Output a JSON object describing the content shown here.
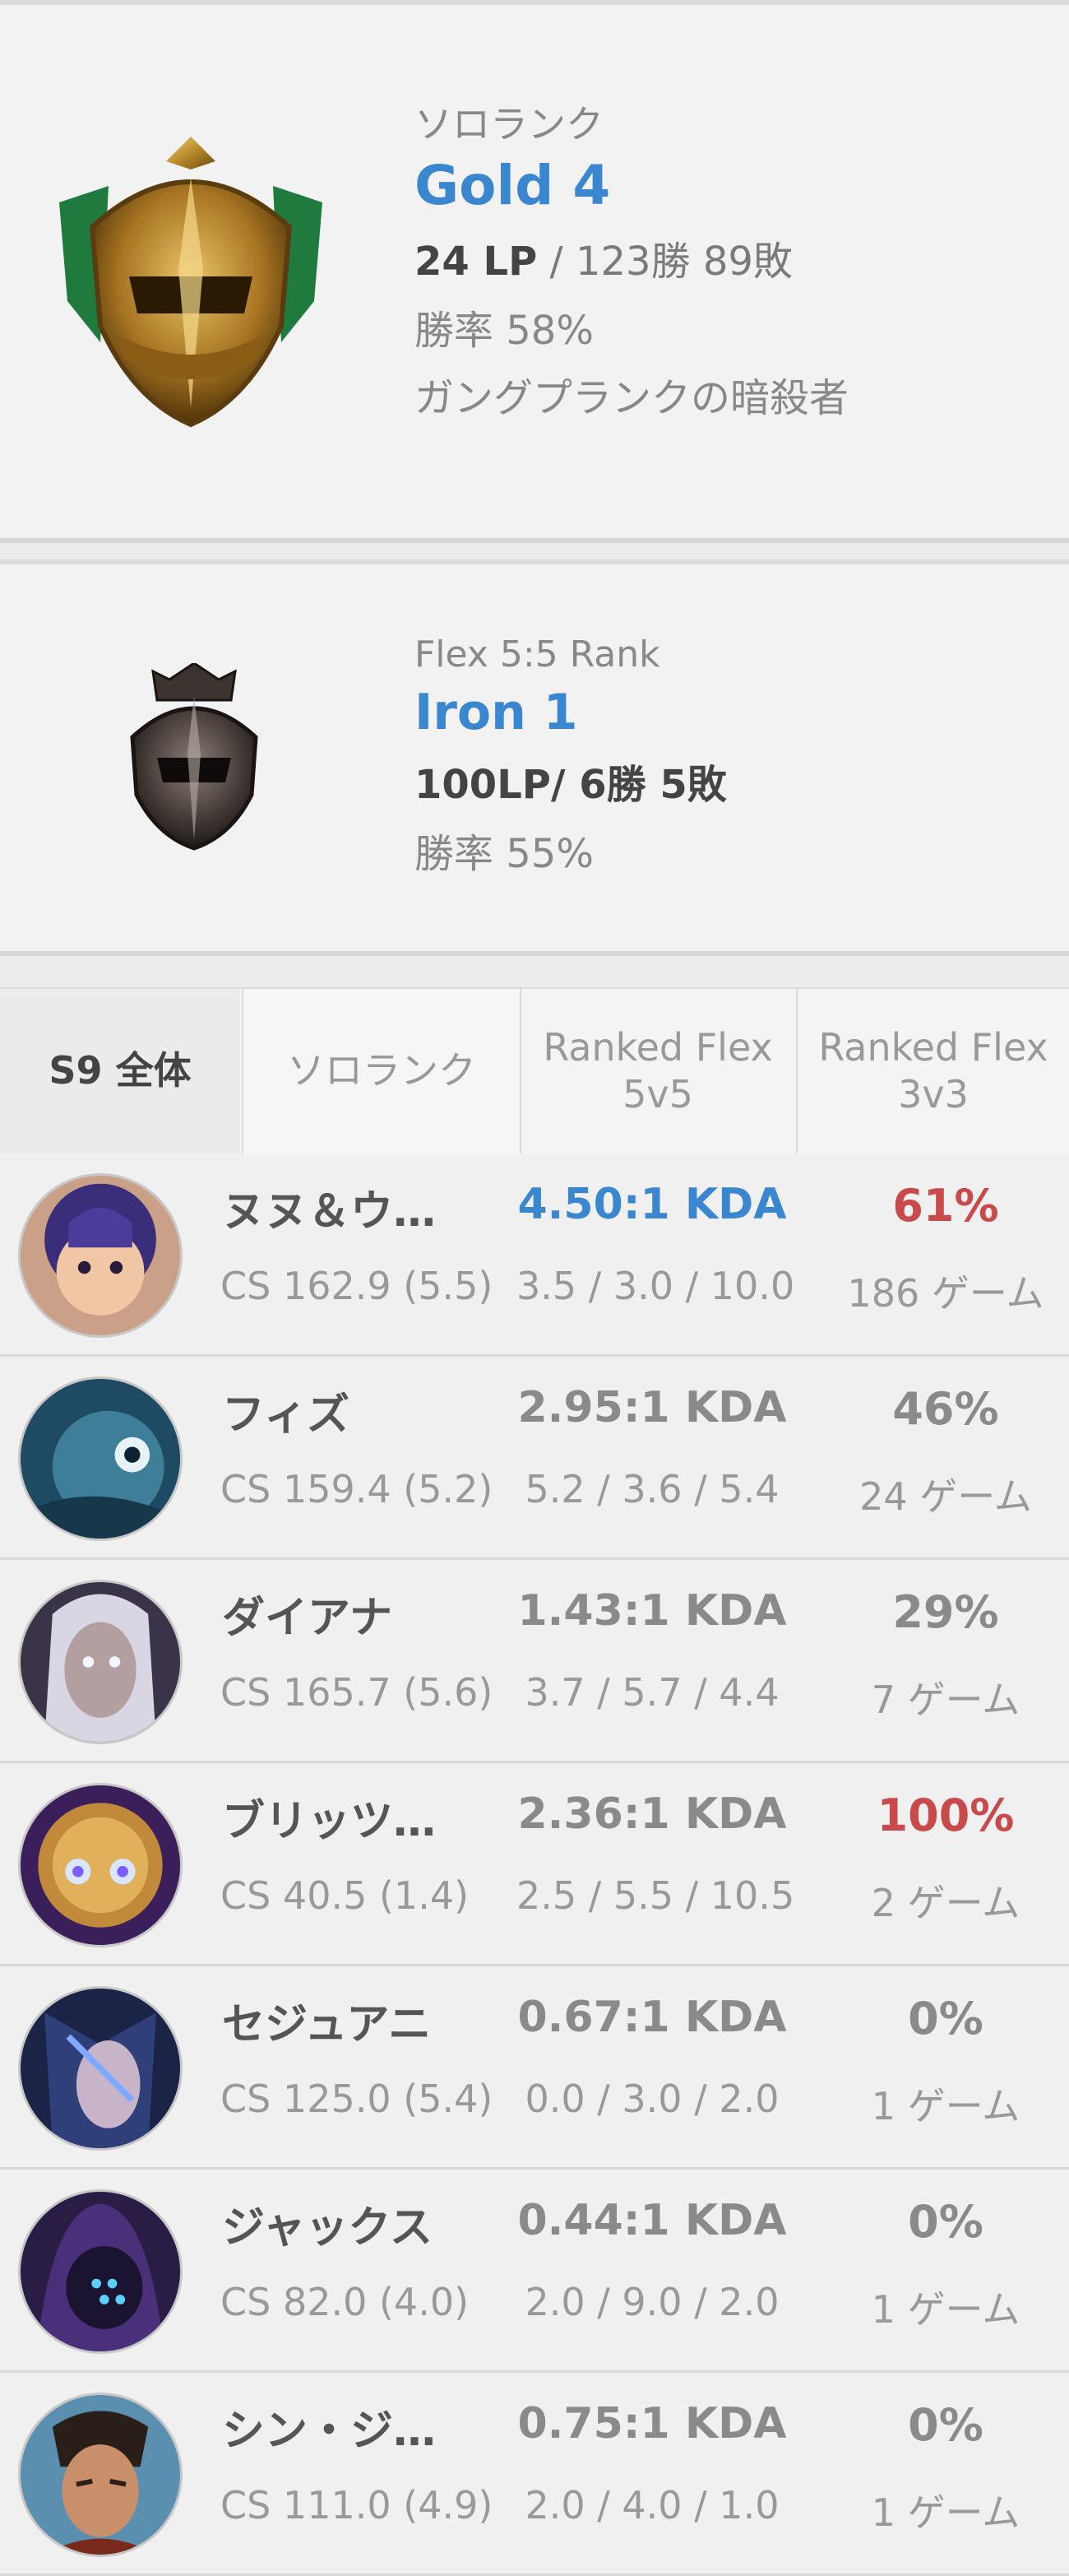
{
  "solo_rank": {
    "queue": "ソロランク",
    "tier": "Gold 4",
    "lp": "24 LP",
    "record": " / 123勝 89敗",
    "winrate": "勝率 58%",
    "league": "ガングプランクの暗殺者",
    "emblem_icon": "gold-helmet-emblem"
  },
  "flex_rank": {
    "queue": "Flex 5:5 Rank",
    "tier": "Iron 1",
    "lp": "100LP",
    "record": "/ 6勝 5敗",
    "winrate": "勝率 55%",
    "emblem_icon": "iron-helmet-emblem"
  },
  "tabs": [
    {
      "label": "S9 全体"
    },
    {
      "label": "ソロランク"
    },
    {
      "label": "Ranked Flex 5v5"
    },
    {
      "label": "Ranked Flex 3v3"
    }
  ],
  "champions": [
    {
      "name": "ヌヌ＆ウ…",
      "cs": "CS 162.9 (5.5)",
      "kda": "4.50:1 KDA",
      "kda_detail": "3.5 / 3.0 / 10.0",
      "winrate": "61%",
      "games": "186 ゲーム"
    },
    {
      "name": "フィズ",
      "cs": "CS 159.4 (5.2)",
      "kda": "2.95:1 KDA",
      "kda_detail": "5.2 / 3.6 / 5.4",
      "winrate": "46%",
      "games": "24 ゲーム"
    },
    {
      "name": "ダイアナ",
      "cs": "CS 165.7 (5.6)",
      "kda": "1.43:1 KDA",
      "kda_detail": "3.7 / 5.7 / 4.4",
      "winrate": "29%",
      "games": "7 ゲーム"
    },
    {
      "name": "ブリッツ…",
      "cs": "CS 40.5 (1.4)",
      "kda": "2.36:1 KDA",
      "kda_detail": "2.5 / 5.5 / 10.5",
      "winrate": "100%",
      "games": "2 ゲーム"
    },
    {
      "name": "セジュアニ",
      "cs": "CS 125.0 (5.4)",
      "kda": "0.67:1 KDA",
      "kda_detail": "0.0 / 3.0 / 2.0",
      "winrate": "0%",
      "games": "1 ゲーム"
    },
    {
      "name": "ジャックス",
      "cs": "CS 82.0 (4.0)",
      "kda": "0.44:1 KDA",
      "kda_detail": "2.0 / 9.0 / 2.0",
      "winrate": "0%",
      "games": "1 ゲーム"
    },
    {
      "name": "シン・ジ…",
      "cs": "CS 111.0 (4.9)",
      "kda": "0.75:1 KDA",
      "kda_detail": "2.0 / 4.0 / 1.0",
      "winrate": "0%",
      "games": "1 ゲーム"
    }
  ],
  "colors": {
    "accent_blue": "#3a86cf",
    "winrate_red": "#c94a4a",
    "muted": "#8a8a8a"
  }
}
